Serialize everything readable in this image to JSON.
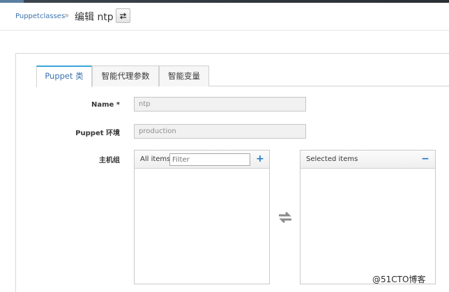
{
  "breadcrumb": {
    "parent": "Puppetclasses",
    "separator": "»",
    "current": "编辑 ntp"
  },
  "header": {
    "switcher_icon": "swap-arrows-icon"
  },
  "tabs": [
    {
      "label": "Puppet 类",
      "active": true
    },
    {
      "label": "智能代理参数",
      "active": false
    },
    {
      "label": "智能变量",
      "active": false
    }
  ],
  "form": {
    "name": {
      "label": "Name *",
      "value": "ntp"
    },
    "environment": {
      "label": "Puppet 环境",
      "value": "production"
    },
    "hostgroups": {
      "label": "主机组",
      "all_items": {
        "title": "All items",
        "filter_placeholder": "Filter",
        "add_icon": "plus-icon",
        "items": []
      },
      "selected_items": {
        "title": "Selected items",
        "remove_icon": "minus-icon",
        "items": []
      },
      "transfer_icon": "swap-arrows-icon"
    }
  },
  "watermark": "@51CTO博客",
  "colors": {
    "accent_blue": "#3b73af",
    "tab_top_border": "#39a5dc",
    "icon_blue": "#1f77c0"
  }
}
